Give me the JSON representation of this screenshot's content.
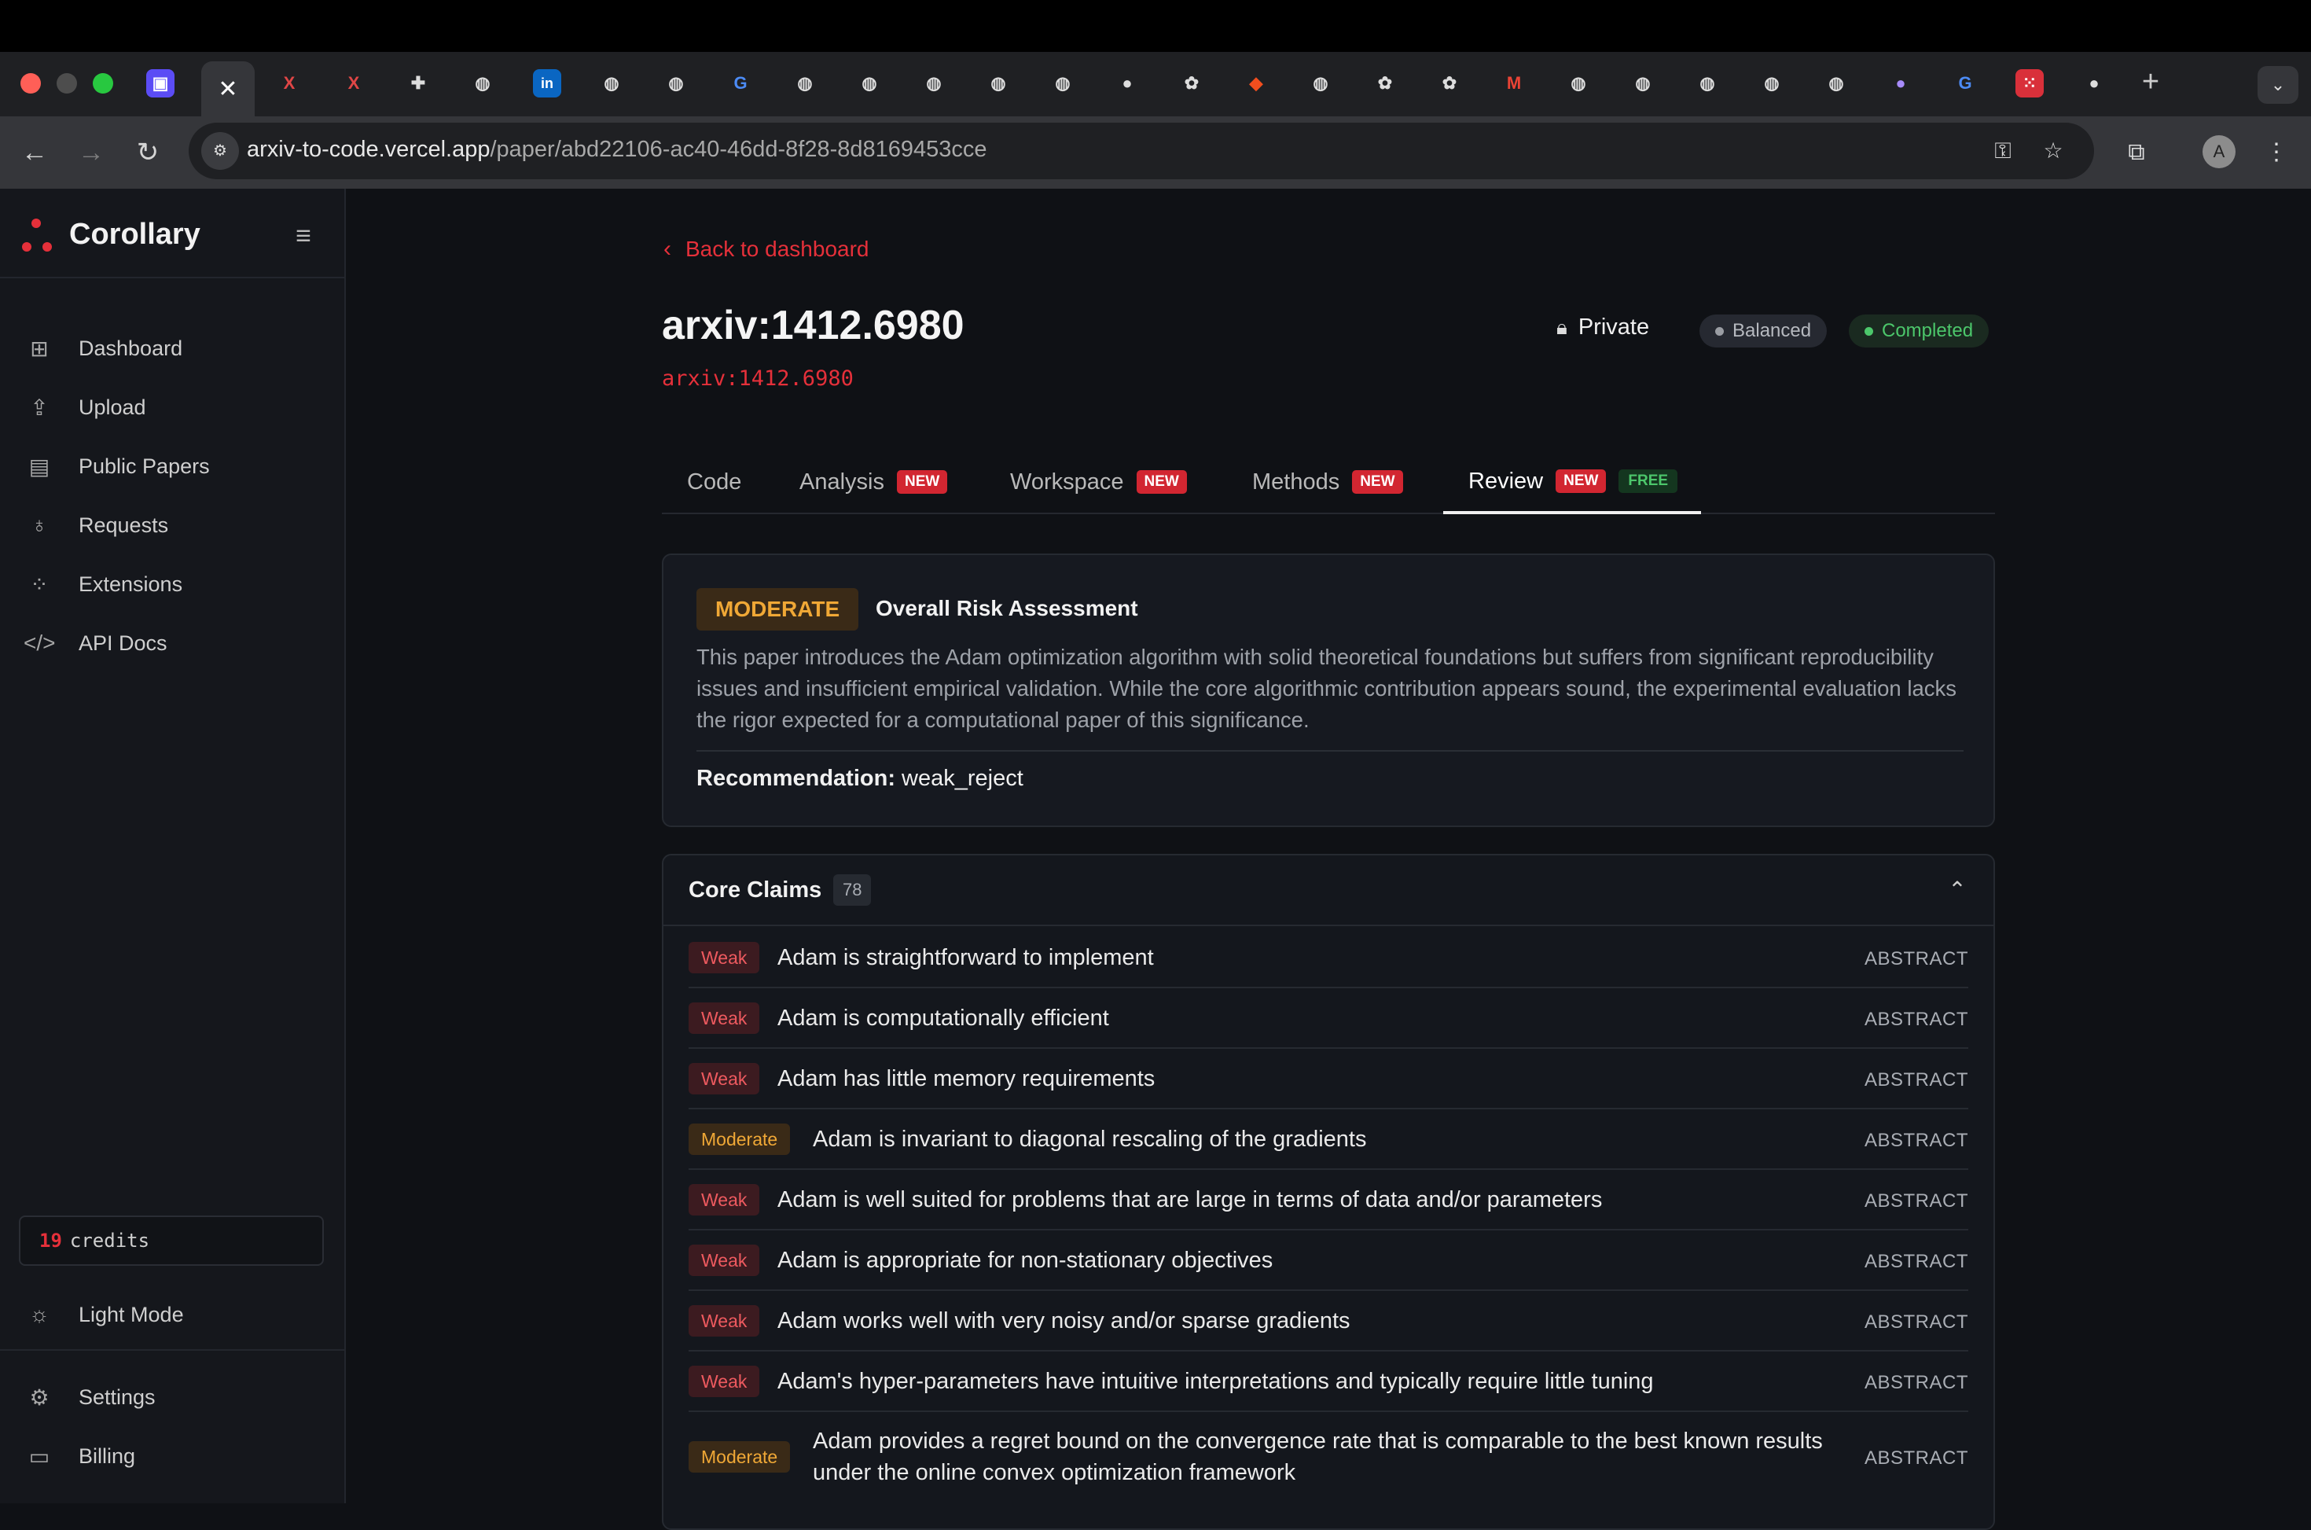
{
  "browser": {
    "url_host": "arxiv-to-code.vercel.app",
    "url_path": "/paper/abd22106-ac40-46dd-8f28-8d8169453cce",
    "active_tab_icon": "close-icon",
    "profile_initial": "A"
  },
  "sidebar": {
    "brand": "Corollary",
    "items": [
      {
        "label": "Dashboard",
        "icon": "grid-icon"
      },
      {
        "label": "Upload",
        "icon": "upload-icon"
      },
      {
        "label": "Public Papers",
        "icon": "document-icon"
      },
      {
        "label": "Requests",
        "icon": "lightbulb-icon"
      },
      {
        "label": "Extensions",
        "icon": "extensions-icon"
      },
      {
        "label": "API Docs",
        "icon": "code-icon"
      }
    ],
    "credits_count": "19",
    "credits_label": "credits",
    "light_mode": "Light Mode",
    "settings": "Settings",
    "billing": "Billing"
  },
  "page": {
    "back_label": "Back to dashboard",
    "title": "arxiv:1412.6980",
    "subtitle": "arxiv:1412.6980",
    "visibility": "Private",
    "mode": "Balanced",
    "status": "Completed"
  },
  "tabs": [
    {
      "label": "Code"
    },
    {
      "label": "Analysis",
      "badge": "NEW"
    },
    {
      "label": "Workspace",
      "badge": "NEW"
    },
    {
      "label": "Methods",
      "badge": "NEW"
    },
    {
      "label": "Review",
      "badge": "NEW",
      "badge2": "FREE",
      "active": true
    }
  ],
  "risk": {
    "level": "MODERATE",
    "title": "Overall Risk Assessment",
    "text": "This paper introduces the Adam optimization algorithm with solid theoretical foundations but suffers from significant reproducibility issues and insufficient empirical validation. While the core algorithmic contribution appears sound, the experimental evaluation lacks the rigor expected for a computational paper of this significance.",
    "recommendation_label": "Recommendation:",
    "recommendation_value": "weak_reject"
  },
  "claims": {
    "title": "Core Claims",
    "count": "78",
    "rows": [
      {
        "strength": "Weak",
        "text": "Adam is straightforward to implement",
        "source": "ABSTRACT"
      },
      {
        "strength": "Weak",
        "text": "Adam is computationally efficient",
        "source": "ABSTRACT"
      },
      {
        "strength": "Weak",
        "text": "Adam has little memory requirements",
        "source": "ABSTRACT"
      },
      {
        "strength": "Moderate",
        "text": "Adam is invariant to diagonal rescaling of the gradients",
        "source": "ABSTRACT"
      },
      {
        "strength": "Weak",
        "text": "Adam is well suited for problems that are large in terms of data and/or parameters",
        "source": "ABSTRACT"
      },
      {
        "strength": "Weak",
        "text": "Adam is appropriate for non-stationary objectives",
        "source": "ABSTRACT"
      },
      {
        "strength": "Weak",
        "text": "Adam works well with very noisy and/or sparse gradients",
        "source": "ABSTRACT"
      },
      {
        "strength": "Weak",
        "text": "Adam's hyper-parameters have intuitive interpretations and typically require little tuning",
        "source": "ABSTRACT"
      },
      {
        "strength": "Moderate",
        "text": "Adam provides a regret bound on the convergence rate that is comparable to the best known results under the online convex optimization framework",
        "source": "ABSTRACT"
      }
    ]
  },
  "colors": {
    "accent": "#e5303a",
    "weak": "#ee5a5f",
    "moderate": "#f0a836",
    "completed": "#4cc76b"
  }
}
